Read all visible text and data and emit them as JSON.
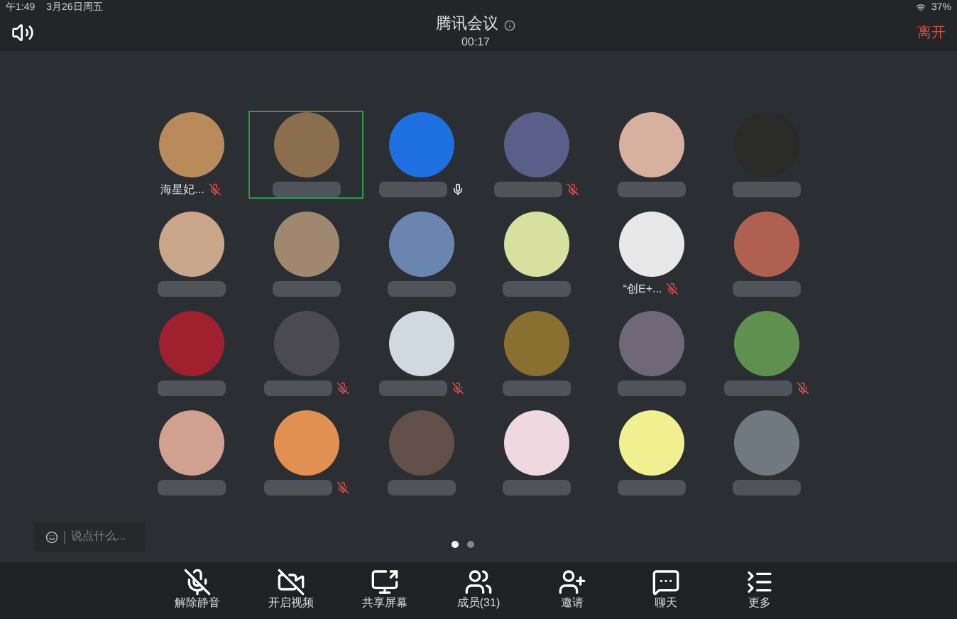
{
  "status_bar": {
    "time": "午1:49",
    "date": "3月26日周五",
    "battery": "37%"
  },
  "header": {
    "title": "腾讯会议",
    "duration": "00:17",
    "leave": "离开"
  },
  "participants": [
    {
      "kind": "named",
      "name": "海星妃...",
      "muted": true,
      "mic_on": false,
      "selected": false
    },
    {
      "kind": "redacted",
      "muted": false,
      "mic_on": false,
      "selected": true
    },
    {
      "kind": "redacted",
      "muted": false,
      "mic_on": true,
      "selected": false
    },
    {
      "kind": "redacted",
      "muted": true,
      "mic_on": false,
      "selected": false
    },
    {
      "kind": "redacted",
      "muted": false,
      "mic_on": false,
      "selected": false
    },
    {
      "kind": "redacted",
      "muted": false,
      "mic_on": false,
      "selected": false
    },
    {
      "kind": "redacted",
      "muted": false,
      "mic_on": false,
      "selected": false
    },
    {
      "kind": "redacted",
      "muted": false,
      "mic_on": false,
      "selected": false
    },
    {
      "kind": "redacted",
      "muted": false,
      "mic_on": false,
      "selected": false
    },
    {
      "kind": "redacted",
      "muted": false,
      "mic_on": false,
      "selected": false
    },
    {
      "kind": "named",
      "name": "“创E+...",
      "muted": true,
      "mic_on": false,
      "selected": false
    },
    {
      "kind": "redacted",
      "muted": false,
      "mic_on": false,
      "selected": false
    },
    {
      "kind": "redacted",
      "muted": false,
      "mic_on": false,
      "selected": false
    },
    {
      "kind": "redacted",
      "muted": true,
      "mic_on": false,
      "selected": false
    },
    {
      "kind": "redacted",
      "muted": true,
      "mic_on": false,
      "selected": false
    },
    {
      "kind": "redacted",
      "muted": false,
      "mic_on": false,
      "selected": false
    },
    {
      "kind": "redacted",
      "muted": false,
      "mic_on": false,
      "selected": false
    },
    {
      "kind": "redacted",
      "muted": true,
      "mic_on": false,
      "selected": false
    },
    {
      "kind": "redacted",
      "muted": false,
      "mic_on": false,
      "selected": false
    },
    {
      "kind": "redacted",
      "muted": true,
      "mic_on": false,
      "selected": false
    },
    {
      "kind": "redacted",
      "muted": false,
      "mic_on": false,
      "selected": false
    },
    {
      "kind": "redacted",
      "muted": false,
      "mic_on": false,
      "selected": false
    },
    {
      "kind": "redacted",
      "muted": false,
      "mic_on": false,
      "selected": false
    },
    {
      "kind": "redacted",
      "muted": false,
      "mic_on": false,
      "selected": false
    }
  ],
  "chat_input": {
    "placeholder": "说点什么..."
  },
  "pages": [
    {
      "selected": true
    },
    {
      "selected": false
    }
  ],
  "toolbar": [
    {
      "kind": "unmute",
      "label": "解除静音"
    },
    {
      "kind": "video",
      "label": "开启视频"
    },
    {
      "kind": "share",
      "label": "共享屏幕"
    },
    {
      "kind": "members",
      "label": "成员(31)"
    },
    {
      "kind": "invite",
      "label": "邀请"
    },
    {
      "kind": "chat",
      "label": "聊天"
    },
    {
      "kind": "more",
      "label": "更多"
    }
  ]
}
